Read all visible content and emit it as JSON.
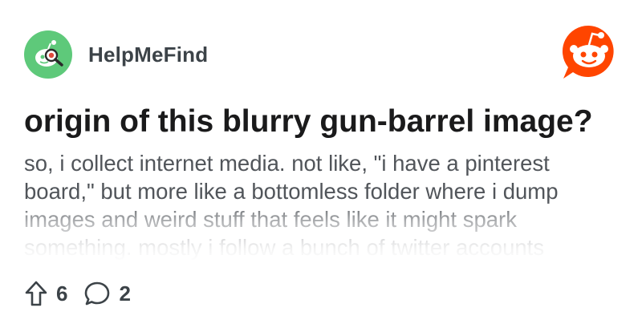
{
  "community": {
    "name": "HelpMeFind",
    "avatar_icon": "magnifier-snoo-icon",
    "avatar_color": "#5ec97a"
  },
  "brand": {
    "logo_icon": "reddit-snoo-logo-icon",
    "color": "#ff4500"
  },
  "post": {
    "title": "origin of this blurry gun-barrel image?",
    "body_lines": [
      "so, i collect internet media. not like, \"i have a pinterest",
      "board,\" but more like a bottomless folder where i dump",
      "images and weird stuff that feels like it might spark",
      "something. mostly i follow a bunch of twitter accounts"
    ]
  },
  "stats": {
    "upvotes": "6",
    "comments": "2",
    "upvote_icon": "upvote-arrow-icon",
    "comment_icon": "comment-bubble-icon"
  }
}
